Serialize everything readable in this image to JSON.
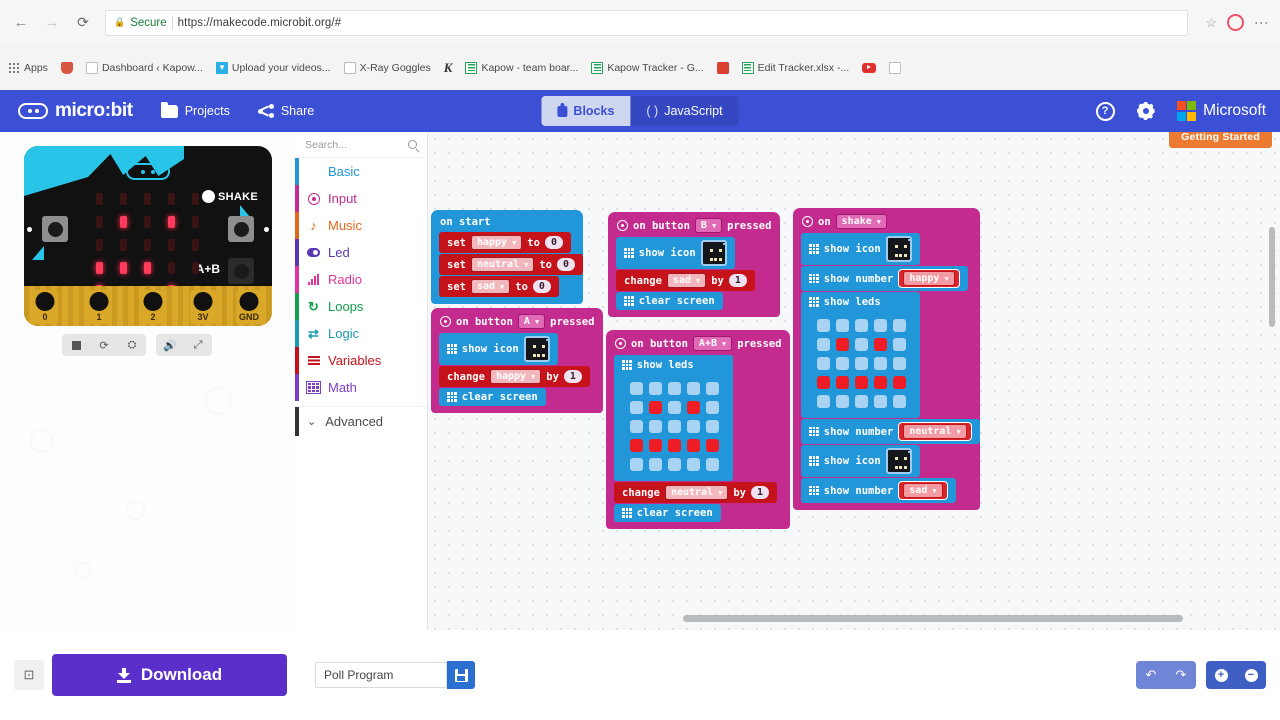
{
  "browser": {
    "secure_label": "Secure",
    "url": "https://makecode.microbit.org/#",
    "back_icon": "back-arrow-icon",
    "forward_icon": "forward-arrow-icon",
    "reload_icon": "reload-icon",
    "bookmarks": [
      {
        "label": "Apps",
        "icon": "apps-grid-icon"
      },
      {
        "label": "",
        "icon": "bookmark-folder-icon"
      },
      {
        "label": "Dashboard ‹ Kapow...",
        "icon": "page-icon"
      },
      {
        "label": "Upload your videos...",
        "icon": "upload-icon"
      },
      {
        "label": "X-Ray Goggles",
        "icon": "page-icon"
      },
      {
        "label": "",
        "icon": "kapow-k-icon"
      },
      {
        "label": "Kapow - team boar...",
        "icon": "sheets-icon"
      },
      {
        "label": "Kapow Tracker - G...",
        "icon": "sheets-icon"
      },
      {
        "label": "",
        "icon": "powerpoint-icon"
      },
      {
        "label": "Edit Tracker.xlsx -...",
        "icon": "excel-icon"
      },
      {
        "label": "",
        "icon": "youtube-icon"
      },
      {
        "label": "",
        "icon": "page-icon"
      }
    ]
  },
  "header": {
    "brand": "micro:bit",
    "projects_label": "Projects",
    "share_label": "Share",
    "blocks_label": "Blocks",
    "javascript_label": "JavaScript",
    "javascript_prefix": "( )",
    "help_label": "?",
    "microsoft_label": "Microsoft",
    "accent_color": "#3c50d6"
  },
  "simulator": {
    "shake_label": "SHAKE",
    "ab_label": "A+B",
    "pin_labels": [
      "0",
      "1",
      "2",
      "3V",
      "GND"
    ],
    "led_on_cells": [
      [
        1,
        1
      ],
      [
        1,
        3
      ],
      [
        3,
        0
      ],
      [
        3,
        1
      ],
      [
        3,
        2
      ],
      [
        4,
        0
      ],
      [
        4,
        3
      ]
    ],
    "controls": [
      "stop-icon",
      "restart-icon",
      "debug-icon",
      "mute-icon",
      "fullscreen-icon"
    ]
  },
  "toolbox": {
    "search_placeholder": "Search...",
    "categories": [
      {
        "label": "Basic",
        "color": "#2196d8",
        "icon": "grid-icon"
      },
      {
        "label": "Input",
        "color": "#c42b8f",
        "icon": "target-icon"
      },
      {
        "label": "Music",
        "color": "#e2681c",
        "icon": "headphones-icon"
      },
      {
        "label": "Led",
        "color": "#5b36b5",
        "icon": "led-icon"
      },
      {
        "label": "Radio",
        "color": "#e0359b",
        "icon": "signal-icon"
      },
      {
        "label": "Loops",
        "color": "#12a04a",
        "icon": "loop-icon"
      },
      {
        "label": "Logic",
        "color": "#1a9bb0",
        "icon": "shuffle-icon"
      },
      {
        "label": "Variables",
        "color": "#c6121a",
        "icon": "lines-icon"
      },
      {
        "label": "Math",
        "color": "#7d3fc9",
        "icon": "calculator-icon"
      }
    ],
    "advanced_label": "Advanced",
    "advanced_icon": "chevron-down-icon"
  },
  "canvas": {
    "getting_started": "Getting Started",
    "blocks": {
      "on_start": {
        "title": "on start",
        "statements": [
          {
            "kind": "set",
            "verb": "set",
            "variable": "happy",
            "mid": "to",
            "value": "0"
          },
          {
            "kind": "set",
            "verb": "set",
            "variable": "neutral",
            "mid": "to",
            "value": "0"
          },
          {
            "kind": "set",
            "verb": "set",
            "variable": "sad",
            "mid": "to",
            "value": "0"
          }
        ]
      },
      "on_button_a": {
        "prefix": "on button",
        "button": "A",
        "suffix": "pressed",
        "statements": [
          {
            "kind": "show_icon",
            "label": "show icon",
            "icon_pixels": [
              [
                1,
                1
              ],
              [
                1,
                3
              ],
              [
                3,
                1
              ],
              [
                3,
                2
              ],
              [
                3,
                3
              ]
            ]
          },
          {
            "kind": "change",
            "verb": "change",
            "variable": "happy",
            "mid": "by",
            "value": "1"
          },
          {
            "kind": "clear",
            "label": "clear screen"
          }
        ]
      },
      "on_button_b": {
        "prefix": "on button",
        "button": "B",
        "suffix": "pressed",
        "statements": [
          {
            "kind": "show_icon",
            "label": "show icon",
            "icon_pixels": [
              [
                1,
                1
              ],
              [
                1,
                3
              ],
              [
                3,
                1
              ],
              [
                3,
                2
              ],
              [
                3,
                3
              ]
            ]
          },
          {
            "kind": "change",
            "verb": "change",
            "variable": "sad",
            "mid": "by",
            "value": "1"
          },
          {
            "kind": "clear",
            "label": "clear screen"
          }
        ]
      },
      "on_button_ab": {
        "prefix": "on button",
        "button": "A+B",
        "suffix": "pressed",
        "statements": [
          {
            "kind": "show_leds",
            "label": "show leds",
            "grid": [
              [
                0,
                0,
                0,
                0,
                0
              ],
              [
                0,
                1,
                0,
                1,
                0
              ],
              [
                0,
                0,
                0,
                0,
                0
              ],
              [
                1,
                1,
                1,
                1,
                1
              ],
              [
                0,
                0,
                0,
                0,
                0
              ]
            ]
          },
          {
            "kind": "change",
            "verb": "change",
            "variable": "neutral",
            "mid": "by",
            "value": "1"
          },
          {
            "kind": "clear",
            "label": "clear screen"
          }
        ]
      },
      "on_shake": {
        "prefix": "on",
        "event": "shake",
        "statements": [
          {
            "kind": "show_icon",
            "label": "show icon",
            "icon_pixels": [
              [
                1,
                1
              ],
              [
                1,
                3
              ],
              [
                3,
                1
              ],
              [
                3,
                2
              ],
              [
                3,
                3
              ]
            ]
          },
          {
            "kind": "show_number",
            "label": "show number",
            "variable": "happy"
          },
          {
            "kind": "show_leds",
            "label": "show leds",
            "grid": [
              [
                0,
                0,
                0,
                0,
                0
              ],
              [
                0,
                1,
                0,
                1,
                0
              ],
              [
                0,
                0,
                0,
                0,
                0
              ],
              [
                1,
                1,
                1,
                1,
                1
              ],
              [
                0,
                0,
                0,
                0,
                0
              ]
            ]
          },
          {
            "kind": "show_number",
            "label": "show number",
            "variable": "neutral"
          },
          {
            "kind": "show_icon",
            "label": "show icon",
            "icon_pixels": [
              [
                1,
                1
              ],
              [
                1,
                3
              ],
              [
                3,
                1
              ],
              [
                3,
                2
              ],
              [
                3,
                3
              ]
            ]
          },
          {
            "kind": "show_number",
            "label": "show number",
            "variable": "sad"
          }
        ]
      }
    }
  },
  "footer": {
    "expand_icon": "expand-icon",
    "download_label": "Download",
    "project_name": "Poll Program",
    "save_icon": "save-icon",
    "undo_icon": "undo-icon",
    "redo_icon": "redo-icon",
    "zoom_in_label": "+",
    "zoom_out_label": "−"
  }
}
